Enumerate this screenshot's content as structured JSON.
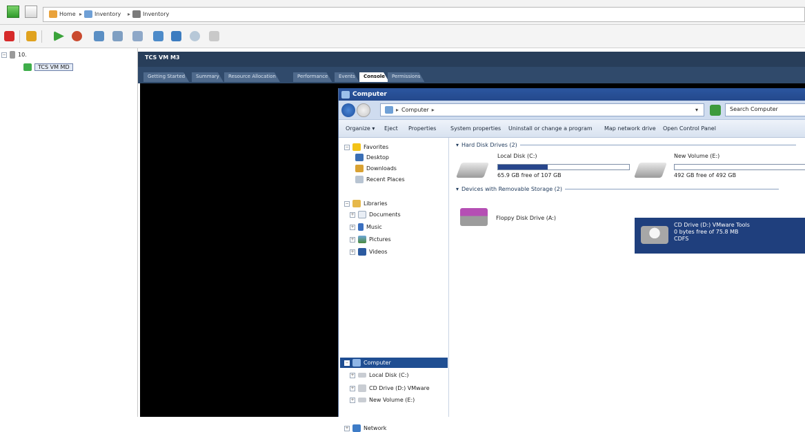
{
  "breadcrumb": {
    "home": "Home",
    "inventory1": "Inventory",
    "inventory2": "Inventory"
  },
  "tree": {
    "root": "10.",
    "vm": "TCS VM MD"
  },
  "vm_header": "TCS VM M3",
  "tabs": [
    {
      "label": "Getting Started"
    },
    {
      "label": "Summary"
    },
    {
      "label": "Resource Allocation"
    },
    {
      "label": "Performance"
    },
    {
      "label": "Events"
    },
    {
      "label": "Console"
    },
    {
      "label": "Permissions"
    }
  ],
  "explorer": {
    "title": "Computer",
    "address": "Computer",
    "search_placeholder": "Search Computer",
    "commands": [
      "Organize",
      "Eject",
      "Properties",
      "System properties",
      "Uninstall or change a program",
      "Map network drive",
      "Open Control Panel"
    ],
    "nav": {
      "favorites": "Favorites",
      "desktop": "Desktop",
      "downloads": "Downloads",
      "recent": "Recent Places",
      "libraries": "Libraries",
      "documents": "Documents",
      "music": "Music",
      "pictures": "Pictures",
      "videos": "Videos",
      "computer": "Computer",
      "local_disk": "Local Disk (C:)",
      "cd_drive": "CD Drive (D:) VMware",
      "new_volume": "New Volume (E:)",
      "network": "Network"
    },
    "groups": {
      "hdd": "Hard Disk Drives (2)",
      "removable": "Devices with Removable Storage (2)"
    },
    "drives": {
      "c_name": "Local Disk (C:)",
      "c_free": "65.9 GB free of 107 GB",
      "c_used_fraction": 0.38,
      "e_name": "New Volume (E:)",
      "e_free": "492 GB free of 492 GB",
      "e_used_fraction": 0.0,
      "floppy": "Floppy Disk Drive (A:)",
      "cd_name": "CD Drive (D:) VMware Tools",
      "cd_free": "0 bytes free of 75.8 MB",
      "cd_fs": "CDFS"
    }
  },
  "colors": {
    "tab_bar": "#304a6b",
    "vm_header": "#283e5a",
    "selection": "#1f3f7d",
    "console_bg": "#000000",
    "usage_fill": "#27468c"
  }
}
